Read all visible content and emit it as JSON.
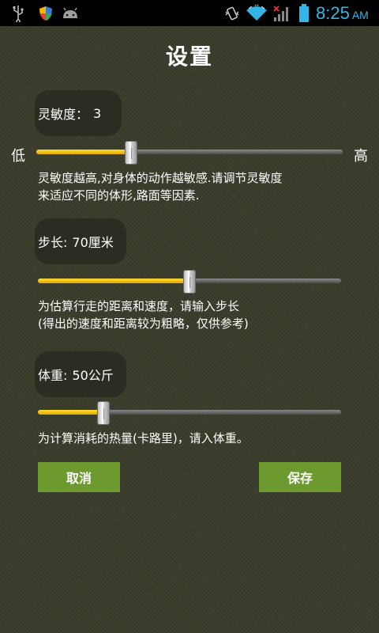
{
  "status_bar": {
    "time": "8:25",
    "ampm": "AM",
    "icons": [
      "usb-icon",
      "shield-icon",
      "android-icon",
      "vibrate-icon",
      "wifi-icon",
      "signal-icon",
      "battery-icon"
    ],
    "accent_color": "#33b5e5"
  },
  "page": {
    "title": "设置"
  },
  "sensitivity": {
    "label": "灵敏度：",
    "value": "3",
    "low_label": "低",
    "high_label": "高",
    "level_fraction": 0.31,
    "desc_lines": [
      "灵敏度越高,对身体的动作越敏感.请调节灵敏度",
      "来适应不同的体形,路面等因素."
    ]
  },
  "step": {
    "label": "步长:",
    "value": "70厘米",
    "level_fraction": 0.5,
    "desc_lines": [
      "为估算行走的距离和速度，请输入步长",
      "(得出的速度和距离较为粗略，仅供参考)"
    ]
  },
  "weight": {
    "label": "体重:",
    "value": "50公斤",
    "level_fraction": 0.217,
    "desc_lines": [
      "为计算消耗的热量(卡路里)，请入体重。"
    ]
  },
  "buttons": {
    "cancel": "取消",
    "save": "保存",
    "color": "#6d9a2e"
  },
  "colors": {
    "slider_fill": "#f2c000",
    "background": "#3b3d2c"
  }
}
